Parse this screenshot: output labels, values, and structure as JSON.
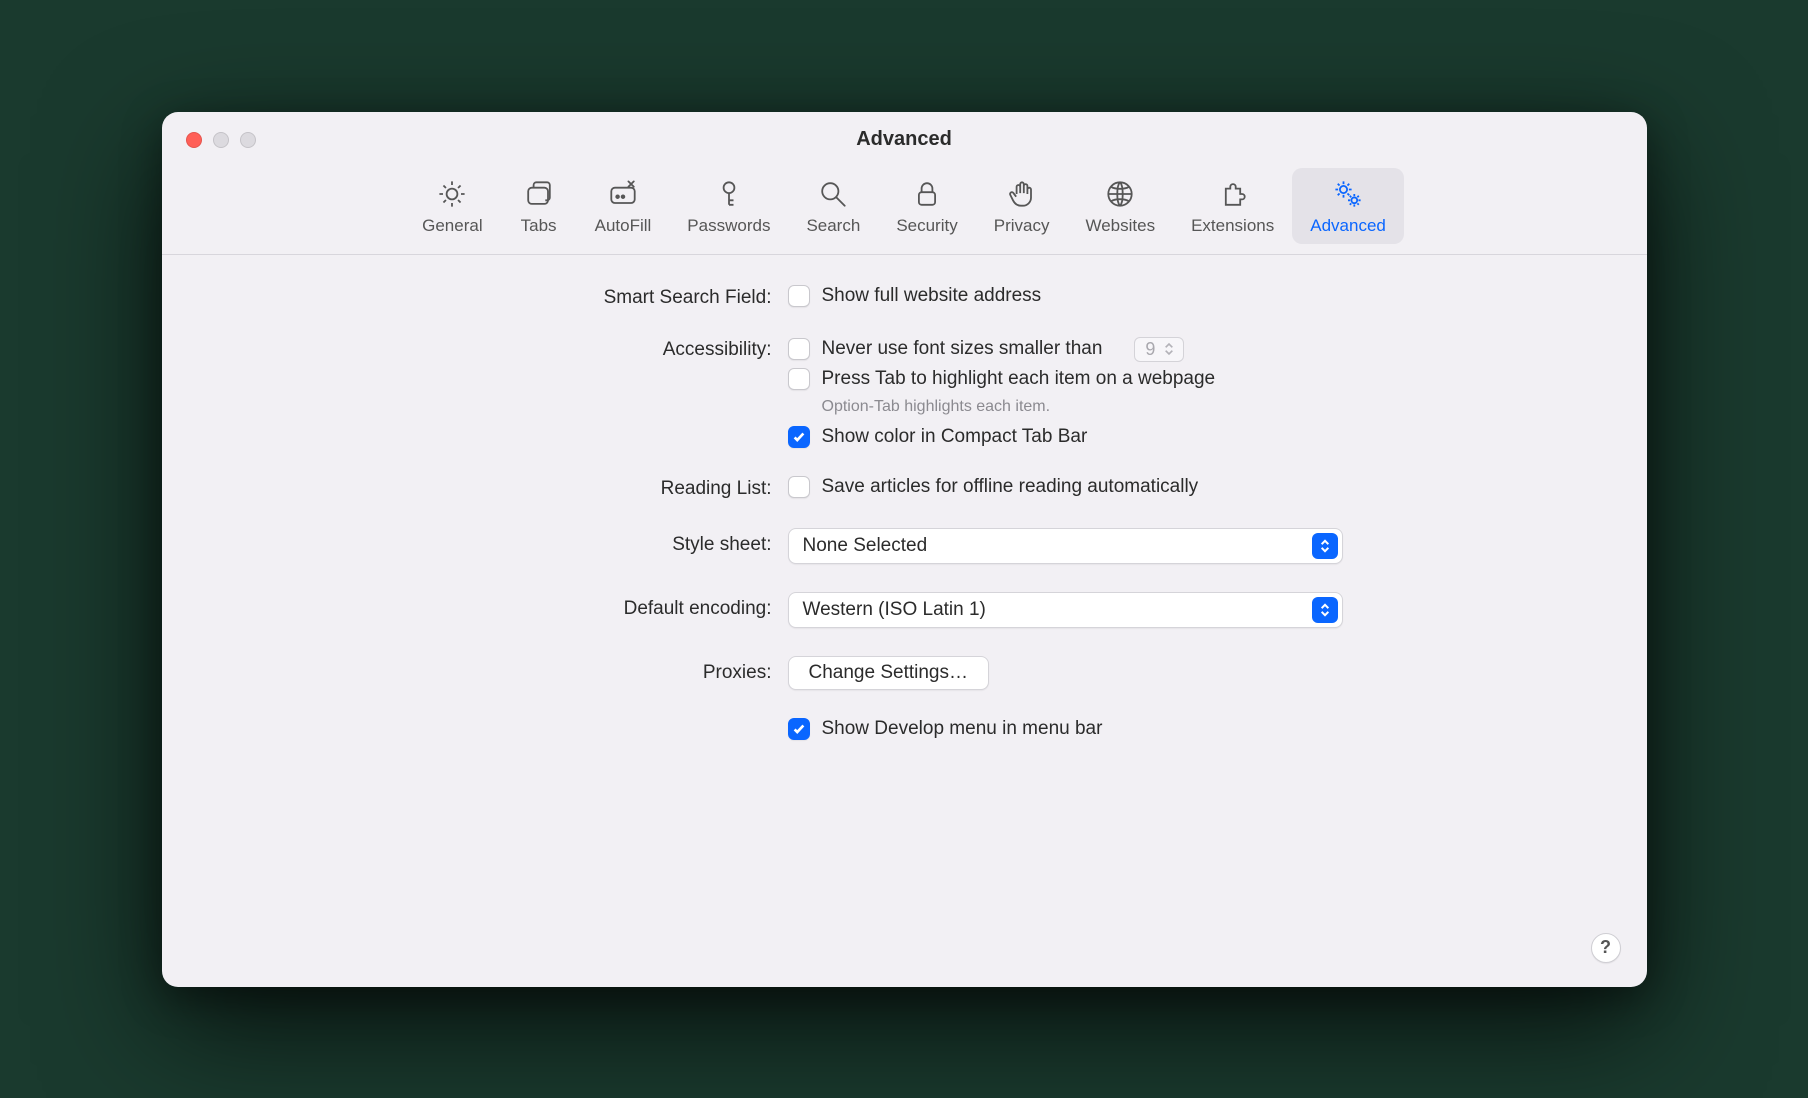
{
  "window": {
    "title": "Advanced"
  },
  "toolbar": {
    "items": [
      {
        "label": "General"
      },
      {
        "label": "Tabs"
      },
      {
        "label": "AutoFill"
      },
      {
        "label": "Passwords"
      },
      {
        "label": "Search"
      },
      {
        "label": "Security"
      },
      {
        "label": "Privacy"
      },
      {
        "label": "Websites"
      },
      {
        "label": "Extensions"
      },
      {
        "label": "Advanced"
      }
    ],
    "active_index": 9
  },
  "sections": {
    "smart_search": {
      "label": "Smart Search Field:",
      "show_full_address": {
        "label": "Show full website address",
        "checked": false
      }
    },
    "accessibility": {
      "label": "Accessibility:",
      "min_font": {
        "label": "Never use font sizes smaller than",
        "checked": false,
        "value": "9"
      },
      "press_tab": {
        "label": "Press Tab to highlight each item on a webpage",
        "checked": false
      },
      "hint": "Option-Tab highlights each item.",
      "compact_color": {
        "label": "Show color in Compact Tab Bar",
        "checked": true
      }
    },
    "reading_list": {
      "label": "Reading List:",
      "save_offline": {
        "label": "Save articles for offline reading automatically",
        "checked": false
      }
    },
    "style_sheet": {
      "label": "Style sheet:",
      "value": "None Selected"
    },
    "default_encoding": {
      "label": "Default encoding:",
      "value": "Western (ISO Latin 1)"
    },
    "proxies": {
      "label": "Proxies:",
      "button": "Change Settings…"
    },
    "develop": {
      "label": "Show Develop menu in menu bar",
      "checked": true
    }
  },
  "help_button": "?"
}
